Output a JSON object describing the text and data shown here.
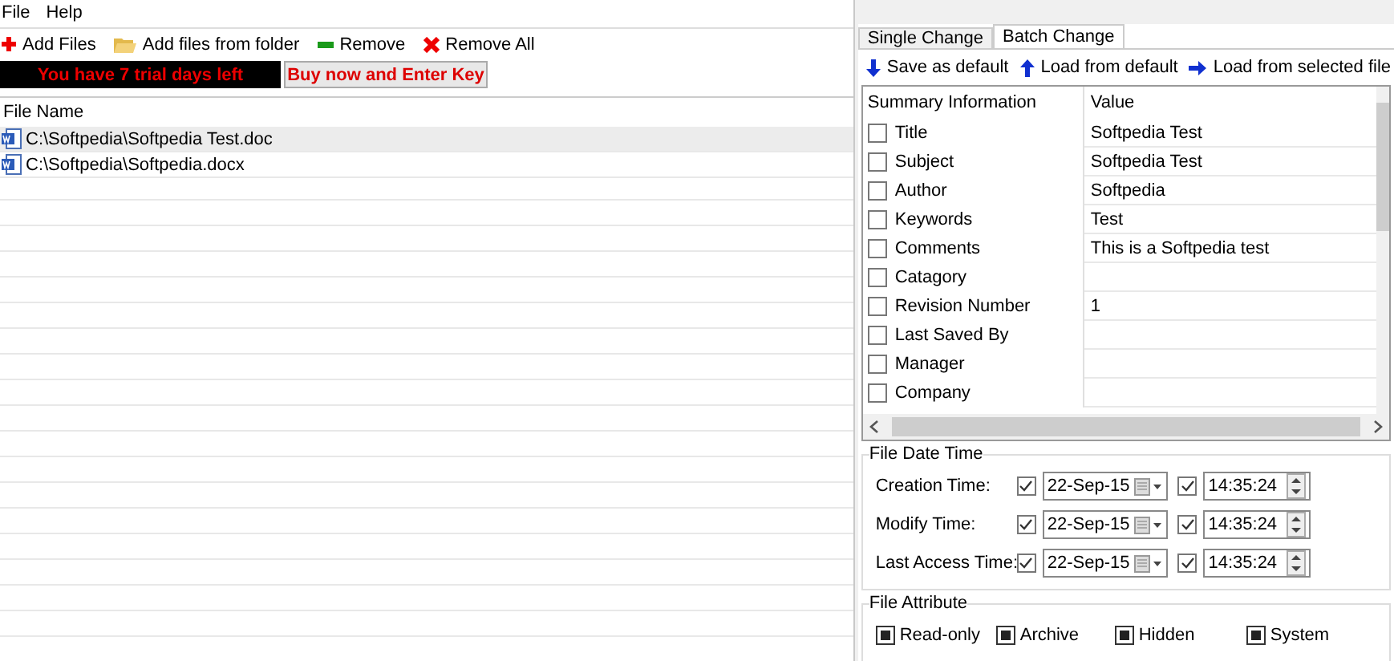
{
  "menu": [
    "File",
    "Help"
  ],
  "toolbar": [
    {
      "label": "Add Files",
      "kind": "add"
    },
    {
      "label": "Add files from folder",
      "kind": "folder"
    },
    {
      "label": "Remove",
      "kind": "remove"
    },
    {
      "label": "Remove All",
      "kind": "removeall"
    }
  ],
  "trial": {
    "message": "You have 7 trial days left",
    "button": "Buy now and Enter Key"
  },
  "file_table": {
    "columns": [
      "File Name"
    ],
    "rows": [
      {
        "name": "C:\\Softpedia\\Softpedia Test.doc",
        "selected": true
      },
      {
        "name": "C:\\Softpedia\\Softpedia.docx",
        "selected": false
      }
    ]
  },
  "tabs": [
    {
      "label": "Single Change",
      "selected": false
    },
    {
      "label": "Batch Change",
      "selected": true
    }
  ],
  "actions": [
    {
      "label": "Save as default",
      "kind": "down"
    },
    {
      "label": "Load from default",
      "kind": "up"
    },
    {
      "label": "Load from selected file",
      "kind": "right"
    }
  ],
  "summary": {
    "columns": [
      "Summary Information",
      "Value"
    ],
    "rows": [
      {
        "name": "Title",
        "value": "Softpedia Test",
        "checked": false
      },
      {
        "name": "Subject",
        "value": "Softpedia Test",
        "checked": false
      },
      {
        "name": "Author",
        "value": "Softpedia",
        "checked": false
      },
      {
        "name": "Keywords",
        "value": "Test",
        "checked": false
      },
      {
        "name": "Comments",
        "value": "This is a Softpedia test",
        "checked": false
      },
      {
        "name": "Catagory",
        "checked": false
      },
      {
        "name": "Revision Number",
        "value": "1",
        "checked": false
      },
      {
        "name": "Last Saved By",
        "checked": false
      },
      {
        "name": "Manager",
        "checked": false
      },
      {
        "name": "Company",
        "checked": false
      }
    ]
  },
  "file_date_time": {
    "title": "File Date Time",
    "rows": [
      {
        "label": "Creation Time:",
        "date_checked": true,
        "date": "22-Sep-15",
        "time_checked": true,
        "time": "14:35:24"
      },
      {
        "label": "Modify Time:",
        "date_checked": true,
        "date": "22-Sep-15",
        "time_checked": true,
        "time": "14:35:24"
      },
      {
        "label": "Last Access Time:",
        "date_checked": true,
        "date": "22-Sep-15",
        "time_checked": true,
        "time": "14:35:24"
      }
    ]
  },
  "file_attribute": {
    "title": "File Attribute",
    "items": [
      {
        "label": "Read-only",
        "indeterminate": true
      },
      {
        "label": "Archive",
        "indeterminate": true
      },
      {
        "label": "Hidden",
        "indeterminate": true
      },
      {
        "label": "System",
        "indeterminate": true
      }
    ]
  }
}
